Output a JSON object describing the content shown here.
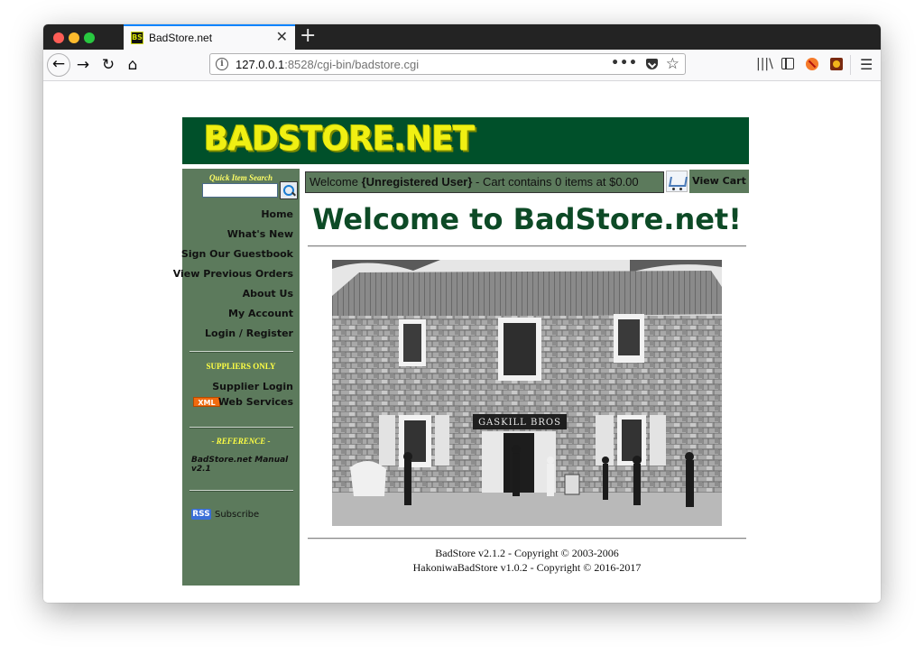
{
  "browser": {
    "tab_title": "BadStore.net",
    "tab_favicon": "BS",
    "tab_close": "✕",
    "new_tab": "+",
    "url_host": "127.0.0.1",
    "url_rest": ":8528/cgi-bin/badstore.cgi",
    "url_more": "•••",
    "nav": {
      "back": "←",
      "forward": "→",
      "reload": "↻",
      "home": "⌂"
    },
    "toolbar": {
      "library": "|||\\",
      "menu": "☰"
    }
  },
  "site": {
    "logo": "BADSTORE.NET",
    "quick_search_label": "Quick Item Search",
    "nav_links": [
      "Home",
      "What's New",
      "Sign Our Guestbook",
      "View Previous Orders",
      "About Us",
      "My Account",
      "Login / Register"
    ],
    "suppliers_heading": "SUPPLIERS ONLY",
    "supplier_login": "Supplier Login",
    "xml_badge": "XML",
    "web_services": "Web Services",
    "reference_heading": "- REFERENCE -",
    "manual": "BadStore.net Manual v2.1",
    "rss_badge": "RSS",
    "subscribe": "Subscribe",
    "welcome_prefix": "Welcome ",
    "welcome_user": "{Unregistered User}",
    "welcome_suffix": " - Cart contains 0 items at $0.00",
    "view_cart": "View Cart",
    "heading": "Welcome to BadStore.net!",
    "store_sign": "GASKILL BROS",
    "footer_line1": "BadStore v2.1.2 - Copyright © 2003-2006",
    "footer_line2": "HakoniwaBadStore v1.0.2 - Copyright © 2016-2017"
  },
  "colors": {
    "nav_green": "#5c7a5c",
    "banner_green": "#00502a",
    "logo_yellow": "#f0f013"
  }
}
